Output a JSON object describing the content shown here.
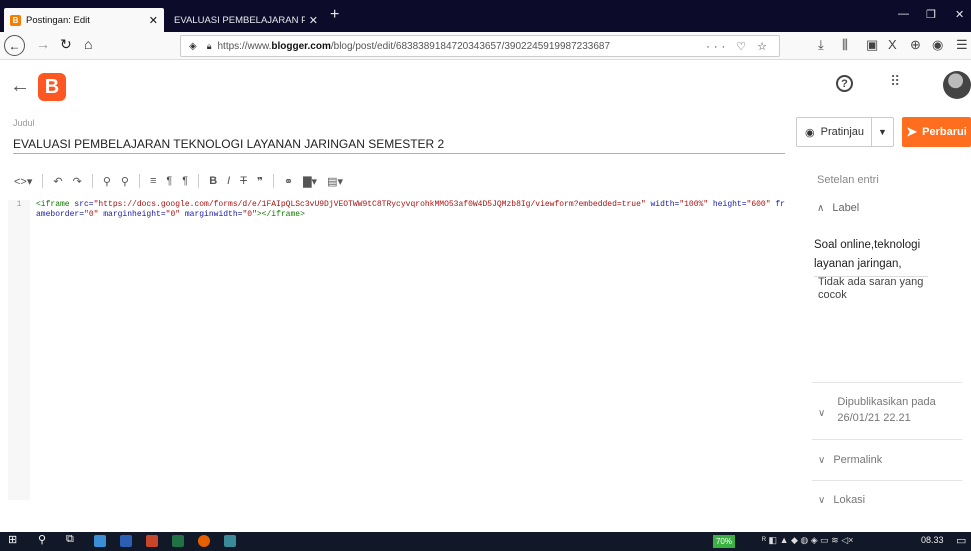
{
  "browser": {
    "tabs": [
      {
        "label": "Postingan: Edit",
        "favicon": "B"
      },
      {
        "label": "EVALUASI PEMBELAJARAN PEMRO"
      }
    ],
    "new_tab": "+",
    "url_prefix": "https://www.",
    "url_domain": "blogger.com",
    "url_path": "/blog/post/edit/6838389184720343657/3902245919987233687",
    "url_icons": "··· ♡ ☆"
  },
  "header": {
    "logo_letter": "B",
    "help_glyph": "?"
  },
  "post": {
    "title_label": "Judul",
    "title": "EVALUASI PEMBELAJARAN TEKNOLOGI LAYANAN JARINGAN SEMESTER 2",
    "preview_label": "Pratinjau",
    "update_label": "Perbarui"
  },
  "editor": {
    "line_number": "1",
    "code_tag_open": "<iframe ",
    "code_attr_src": "src=",
    "code_src_value": "\"https://docs.google.com/forms/d/e/1FAIpQLSc3vU9DjVEOTWW9tC8TRycyvqrohkMMO53af0W4D5JQMzb8Ig/viewform?embedded=true\"",
    "code_attr_width": " width=",
    "code_width_value": "\"100%\"",
    "code_attr_height": " height=",
    "code_height_value": "\"600\"",
    "code_attr_frameborder": " frameborder=",
    "code_frameborder_value": "\"0\"",
    "code_attr_marginheight": " marginheight=",
    "code_marginheight_value": "\"0\"",
    "code_attr_marginwidth": " marginwidth=",
    "code_marginwidth_value": "\"0\"",
    "code_tag_close": "></iframe>"
  },
  "sidebar": {
    "title": "Setelan entri",
    "label_heading": "Label",
    "label_value": "Soal online,teknologi layanan jaringan,",
    "suggestion": "Tidak ada saran yang cocok",
    "published_label": "Dipublikasikan pada",
    "published_date": "26/01/21 22.21",
    "permalink": "Permalink",
    "location": "Lokasi"
  },
  "taskbar": {
    "battery": "70%",
    "time": "08.33"
  },
  "colors": {
    "accent": "#ff6d1f",
    "logo": "#ff5722",
    "tabbar": "#0c0c2a"
  }
}
